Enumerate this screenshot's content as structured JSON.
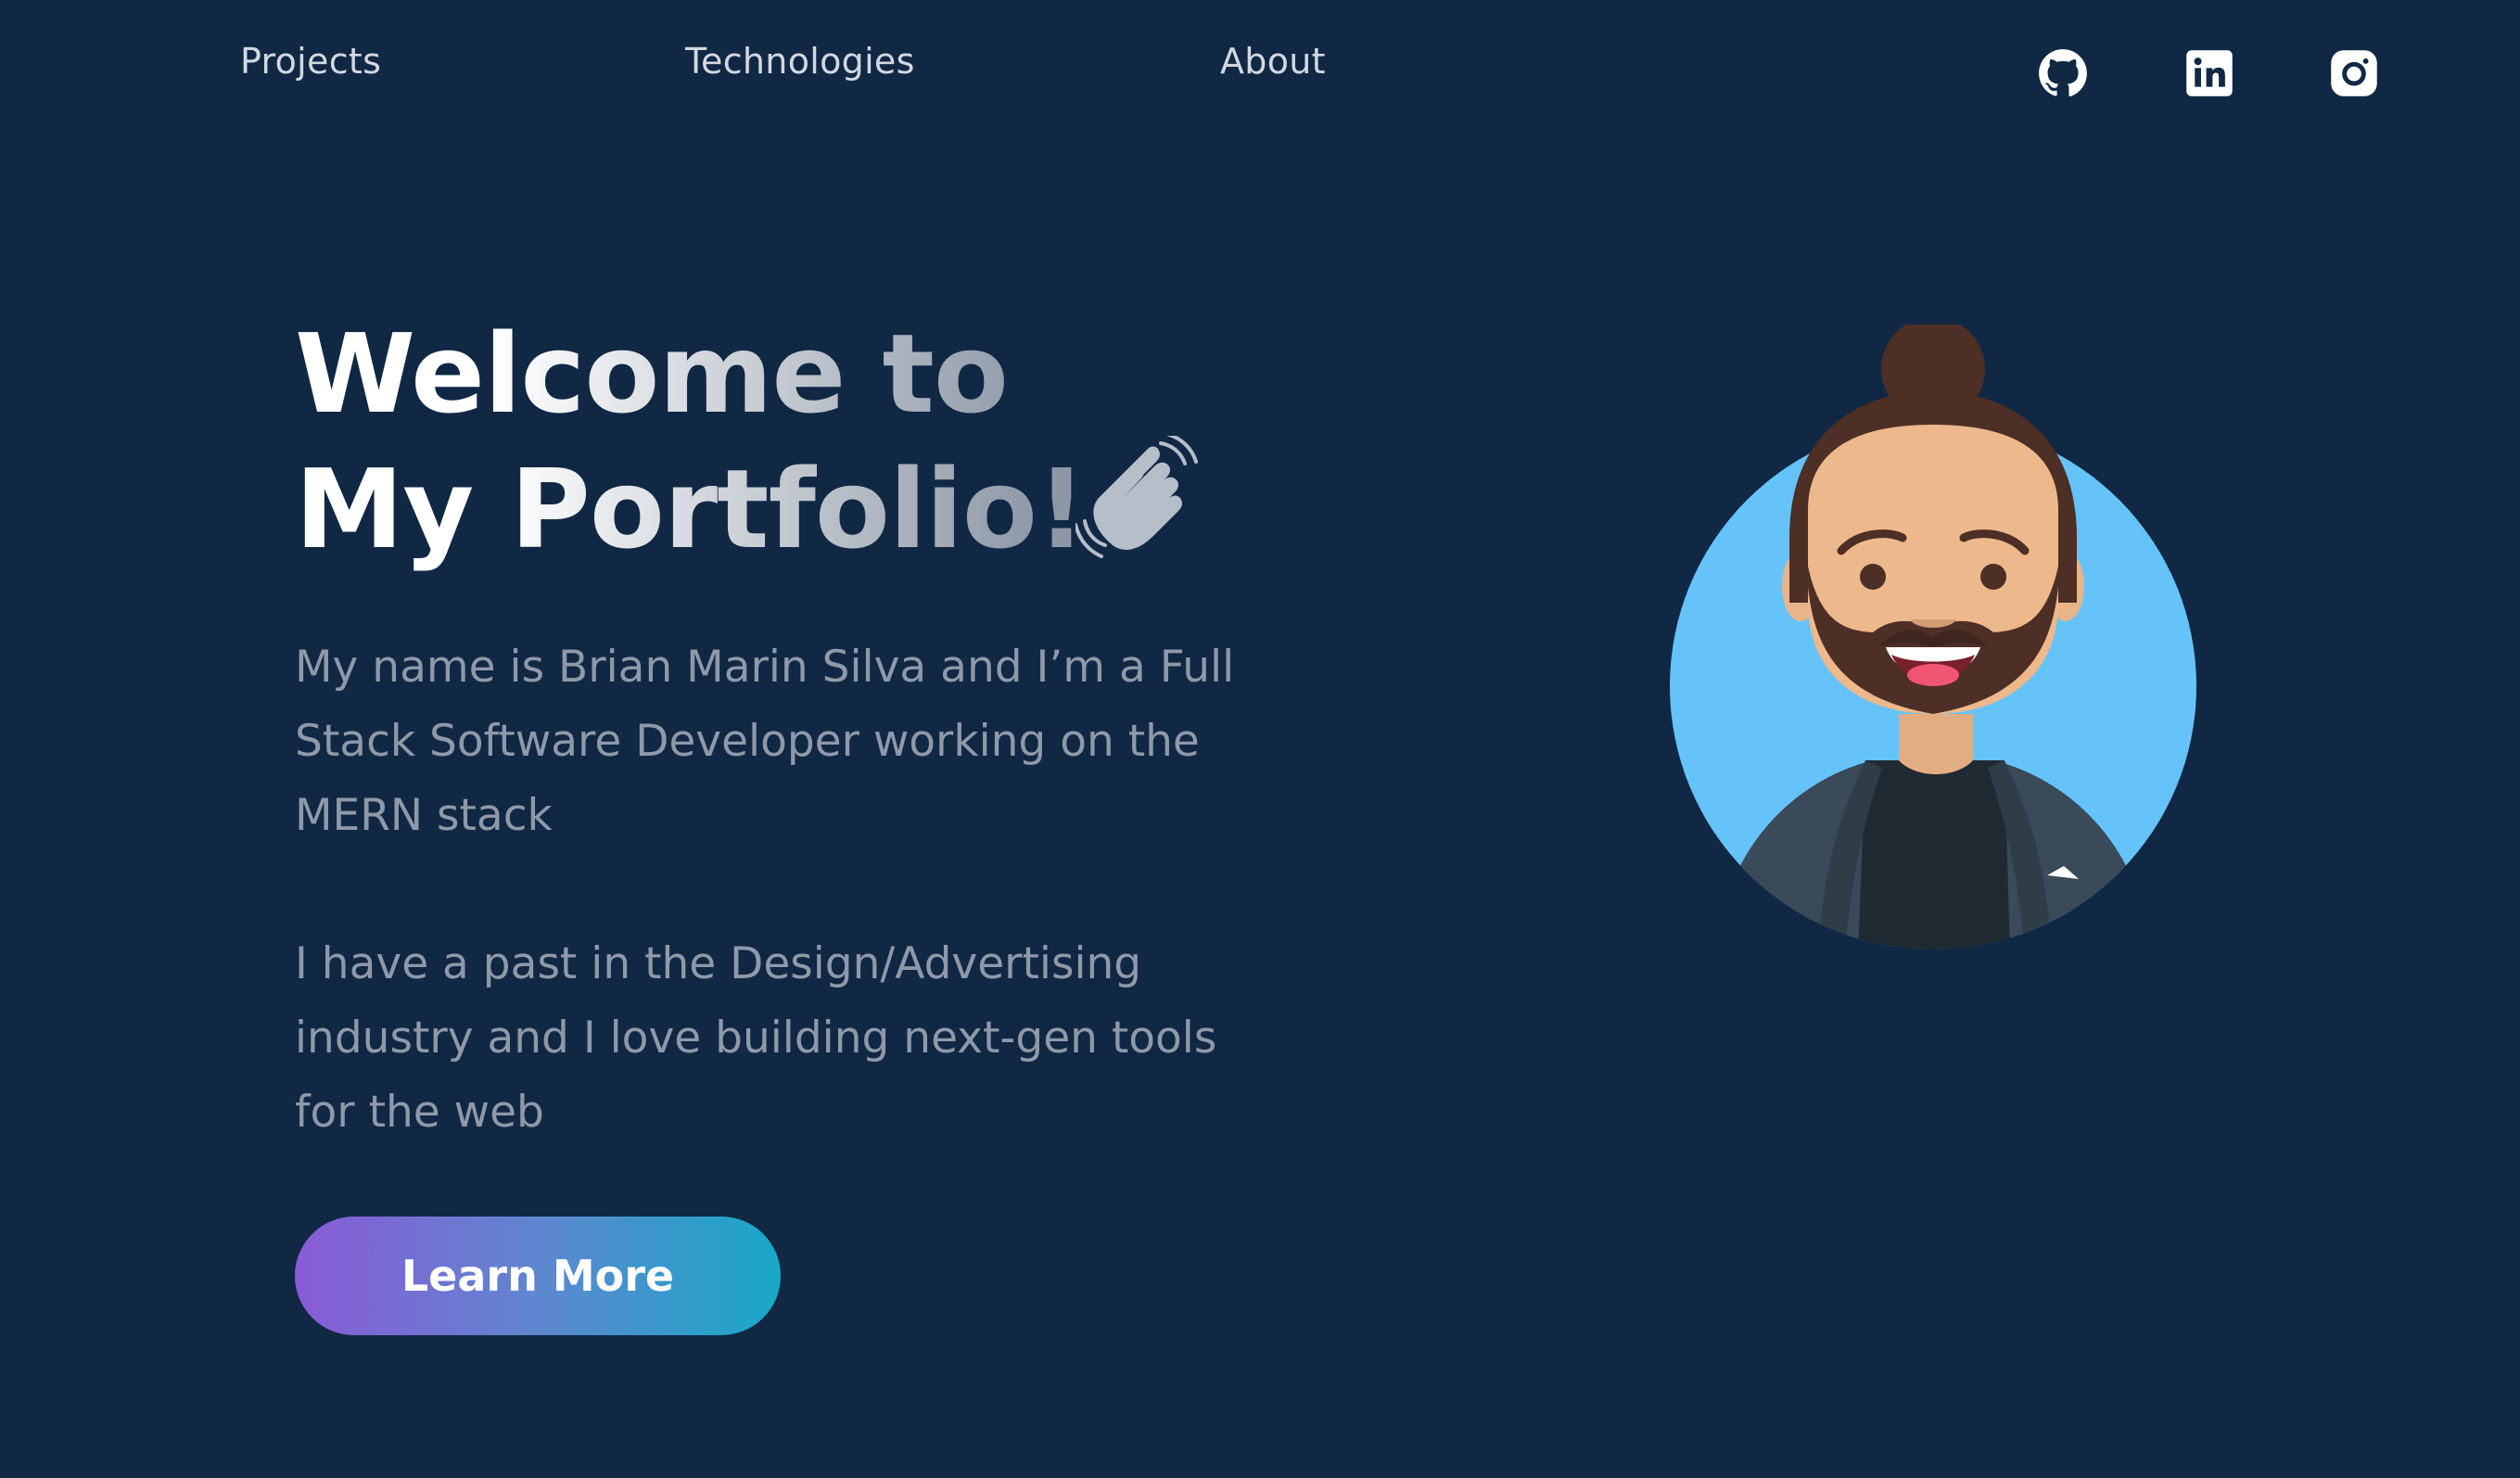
{
  "nav": {
    "items": [
      {
        "label": "Projects"
      },
      {
        "label": "Technologies"
      },
      {
        "label": "About"
      }
    ]
  },
  "social": [
    {
      "icon": "github-icon"
    },
    {
      "icon": "linkedin-icon"
    },
    {
      "icon": "instagram-icon"
    }
  ],
  "hero": {
    "title_line1": "Welcome to",
    "title_line2": "My Portfolio!",
    "paragraph1": "My name is Brian Marin Silva and I’m a Full Stack Software Developer working on the MERN stack",
    "paragraph2": "I have a past in the Design/Advertising industry and I love building next-gen tools for the web",
    "cta_label": "Learn More"
  },
  "colors": {
    "background": "#102844",
    "cta_gradient_start": "#8a5ad6",
    "cta_gradient_end": "#17a9c8",
    "avatar_circle": "#66c3fa"
  }
}
